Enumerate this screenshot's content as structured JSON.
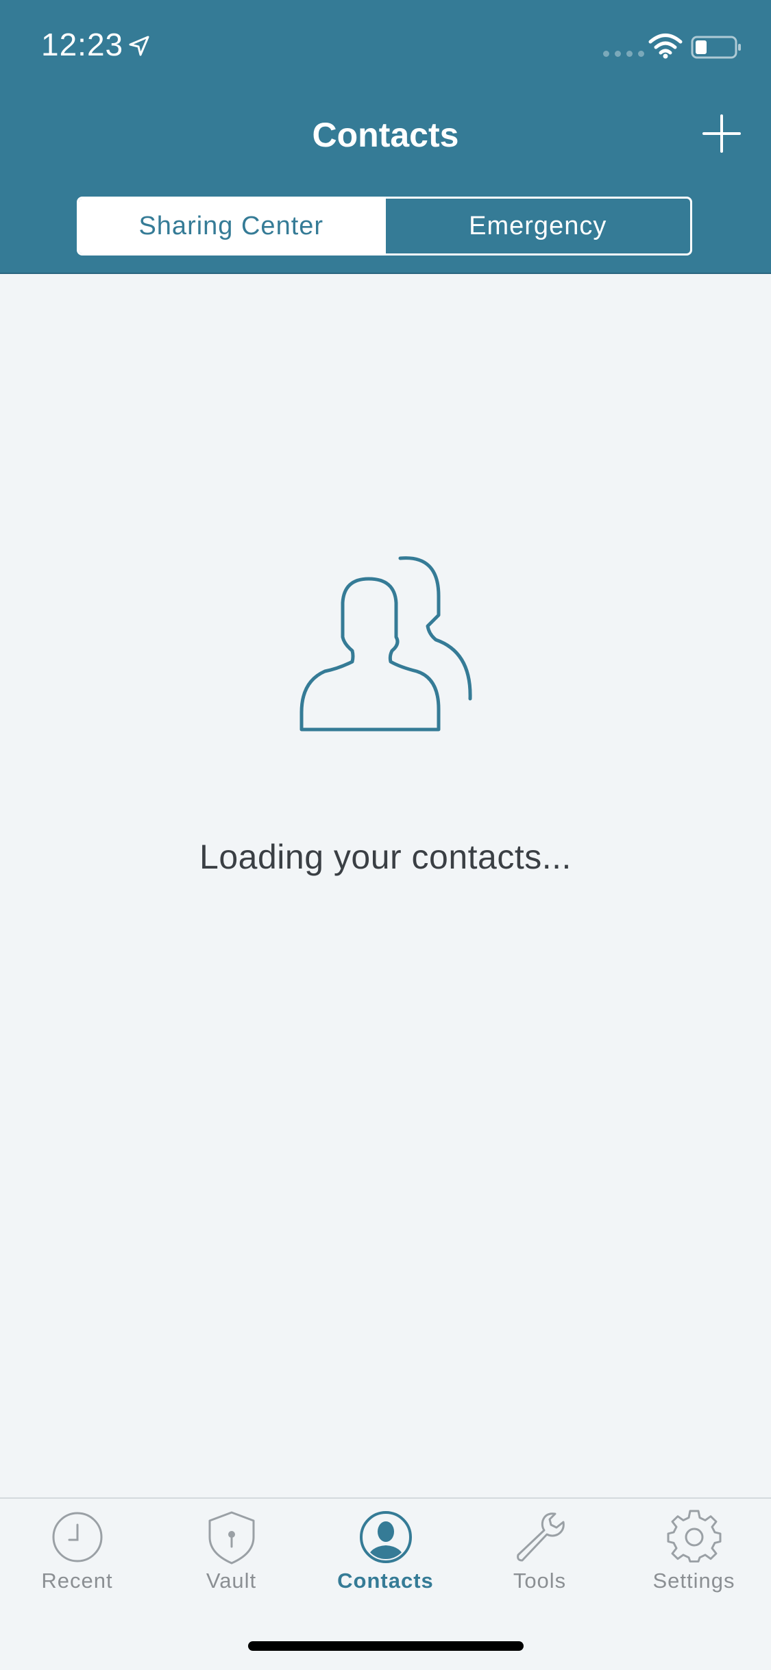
{
  "status_bar": {
    "time": "12:23"
  },
  "header": {
    "title": "Contacts"
  },
  "segments": [
    {
      "label": "Sharing Center",
      "active": true
    },
    {
      "label": "Emergency",
      "active": false
    }
  ],
  "main": {
    "loading_text": "Loading your contacts..."
  },
  "tabbar": {
    "items": [
      {
        "label": "Recent",
        "icon": "clock-icon"
      },
      {
        "label": "Vault",
        "icon": "shield-icon"
      },
      {
        "label": "Contacts",
        "icon": "contacts-icon"
      },
      {
        "label": "Tools",
        "icon": "wrench-icon"
      },
      {
        "label": "Settings",
        "icon": "gear-icon"
      }
    ],
    "active": "Contacts"
  },
  "colors": {
    "brand": "#357b96",
    "background": "#f2f5f7",
    "inactive_tab": "#8b8f93",
    "text": "#3a3f44"
  }
}
